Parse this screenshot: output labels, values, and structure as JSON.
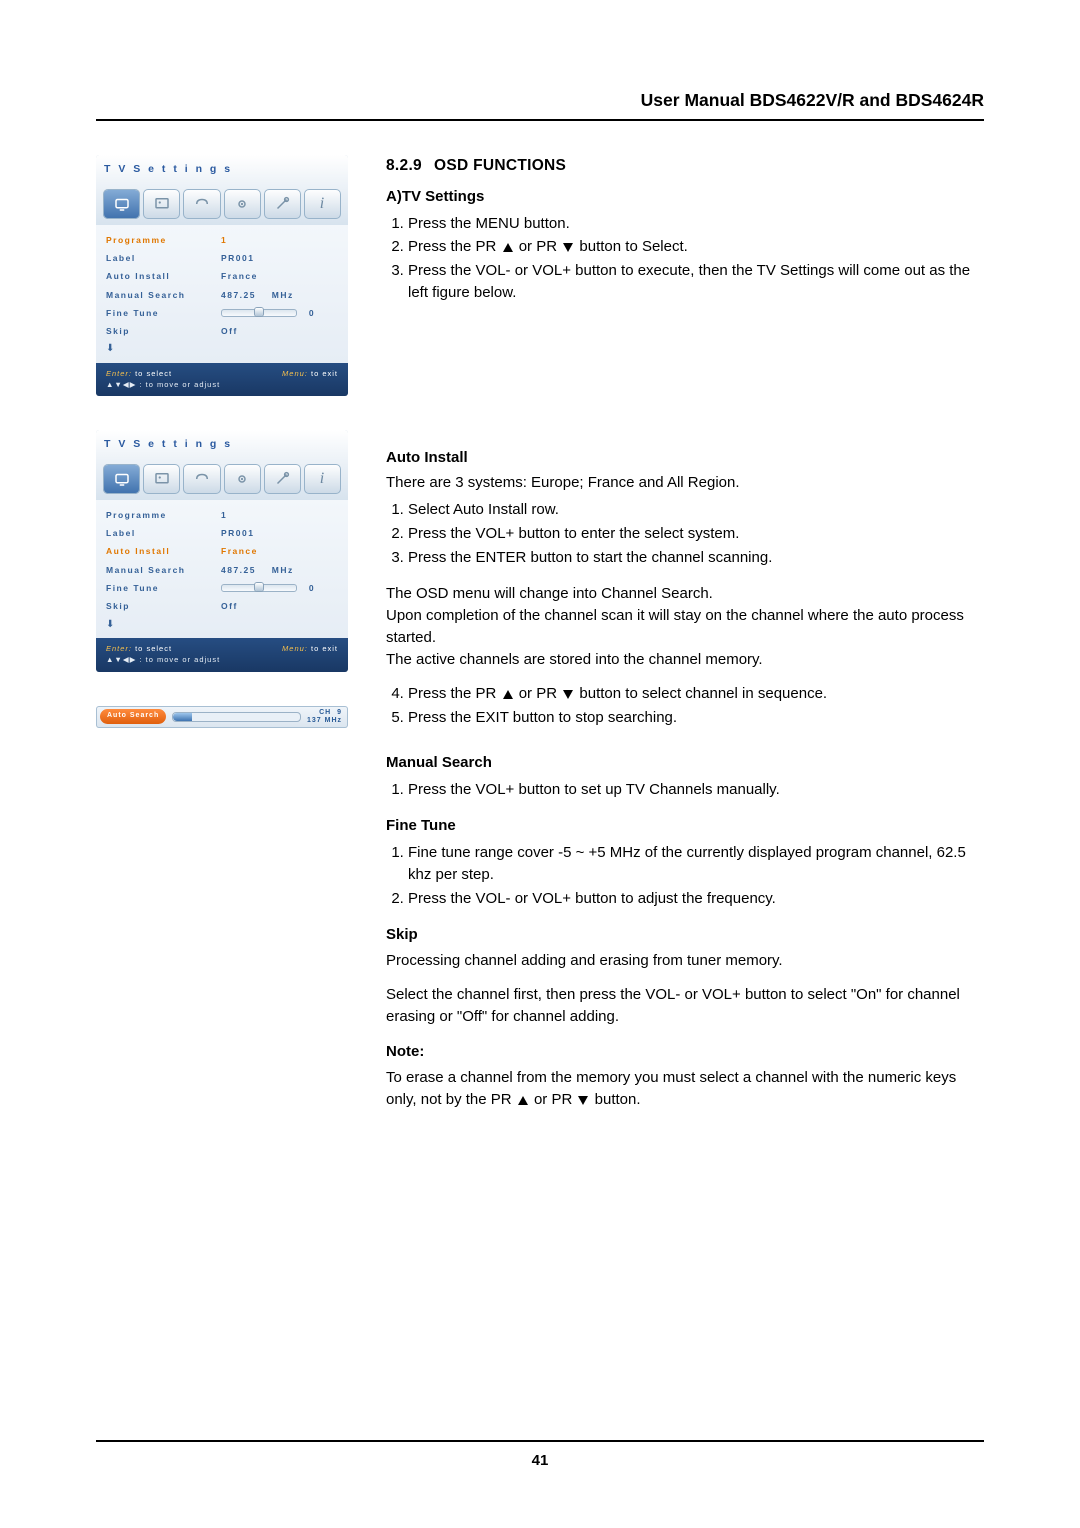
{
  "header": "User Manual BDS4622V/R and BDS4624R",
  "page_number": "41",
  "section": {
    "number": "8.2.9",
    "title": "OSD FUNCTIONS"
  },
  "tv_settings_heading": "A)TV Settings",
  "tv_steps": [
    "Press the MENU button.",
    "Press the PR ▲ or PR ▼ button to Select.",
    "Press the VOL- or VOL+ button to execute, then the TV Settings will come out as the left figure below."
  ],
  "auto_install": {
    "heading": "Auto Install",
    "intro": "There are 3 systems: Europe; France and All Region.",
    "steps_a": [
      "Select Auto Install row.",
      "Press the VOL+ button to enter the select system.",
      "Press the ENTER button to start the channel scanning."
    ],
    "middle": [
      "The OSD menu will change into Channel Search.",
      "Upon completion of the channel scan it will stay on the channel where the auto process started.",
      "The active channels are stored into the channel memory."
    ],
    "steps_b_start": 4,
    "steps_b": [
      "Press the PR ▲ or PR ▼ button to select channel in sequence.",
      "Press the EXIT button to stop searching."
    ]
  },
  "manual_search": {
    "heading": "Manual Search",
    "steps": [
      "Press the VOL+ button to set up TV Channels manually."
    ]
  },
  "fine_tune": {
    "heading": "Fine Tune",
    "steps": [
      "Fine tune range cover -5 ~ +5 MHz of the currently displayed program channel, 62.5 khz per step.",
      "Press the VOL- or VOL+ button to adjust the frequency."
    ]
  },
  "skip": {
    "heading": "Skip",
    "paras": [
      "Processing channel adding and erasing from tuner memory.",
      "Select the channel first, then press the VOL- or VOL+ button to select \"On\" for channel erasing or \"Off\" for channel adding."
    ]
  },
  "note": {
    "heading": "Note:",
    "text": "To erase a channel from the memory you must select a channel with the numeric keys only, not by the PR ▲ or PR ▼ button."
  },
  "osd": {
    "title": "T V  S e t t i n g s",
    "rows": {
      "programme": {
        "label": "Programme",
        "value": "1"
      },
      "label": {
        "label": "Label",
        "value": "PR001"
      },
      "auto": {
        "label": "Auto Install",
        "value": "France"
      },
      "manual": {
        "label": "Manual Search",
        "value": "487.25",
        "unit": "MHz"
      },
      "fine": {
        "label": "Fine Tune",
        "value": "0"
      },
      "skip": {
        "label": "Skip",
        "value": "Off"
      }
    },
    "footer": {
      "enter": "Enter:",
      "enter_text": " to select",
      "menu": "Menu:",
      "menu_text": " to exit",
      "arrows": "▲▼◀▶ :  to move or adjust"
    }
  },
  "autosearch": {
    "label": "Auto Search",
    "ch_label": "CH",
    "ch_value": "9",
    "freq": "137 MHz"
  }
}
